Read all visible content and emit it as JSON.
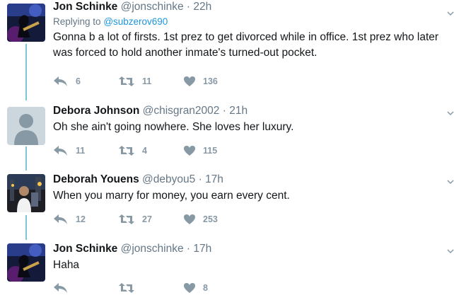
{
  "tweets": [
    {
      "name": "Jon Schinke",
      "handle": "@jonschinke",
      "time": "22h",
      "replying_prefix": "Replying to",
      "replying_to": "@subzerov690",
      "text": "Gonna b a lot of firsts. 1st prez to get divorced while in office. 1st prez who later was forced to hold another inmate's turned-out pocket.",
      "replies": "6",
      "retweets": "11",
      "likes": "136"
    },
    {
      "name": "Debora Johnson",
      "handle": "@chisgran2002",
      "time": "21h",
      "text": "Oh she ain't going nowhere. She loves her luxury.",
      "replies": "11",
      "retweets": "4",
      "likes": "115"
    },
    {
      "name": "Deborah Youens",
      "handle": "@debyou5",
      "time": "17h",
      "text": "When you marry for money, you earn every cent.",
      "replies": "12",
      "retweets": "27",
      "likes": "253"
    },
    {
      "name": "Jon Schinke",
      "handle": "@jonschinke",
      "time": "17h",
      "text": "Haha",
      "replies": "",
      "retweets": "",
      "likes": "8"
    }
  ],
  "separator": "·",
  "colors": {
    "thread_line": "#7cc7d6",
    "link": "#1b95e0",
    "secondary_text": "#657786",
    "icon": "#8899a6"
  },
  "icons": [
    "reply-icon",
    "retweet-icon",
    "like-icon",
    "chevron-down-icon"
  ]
}
